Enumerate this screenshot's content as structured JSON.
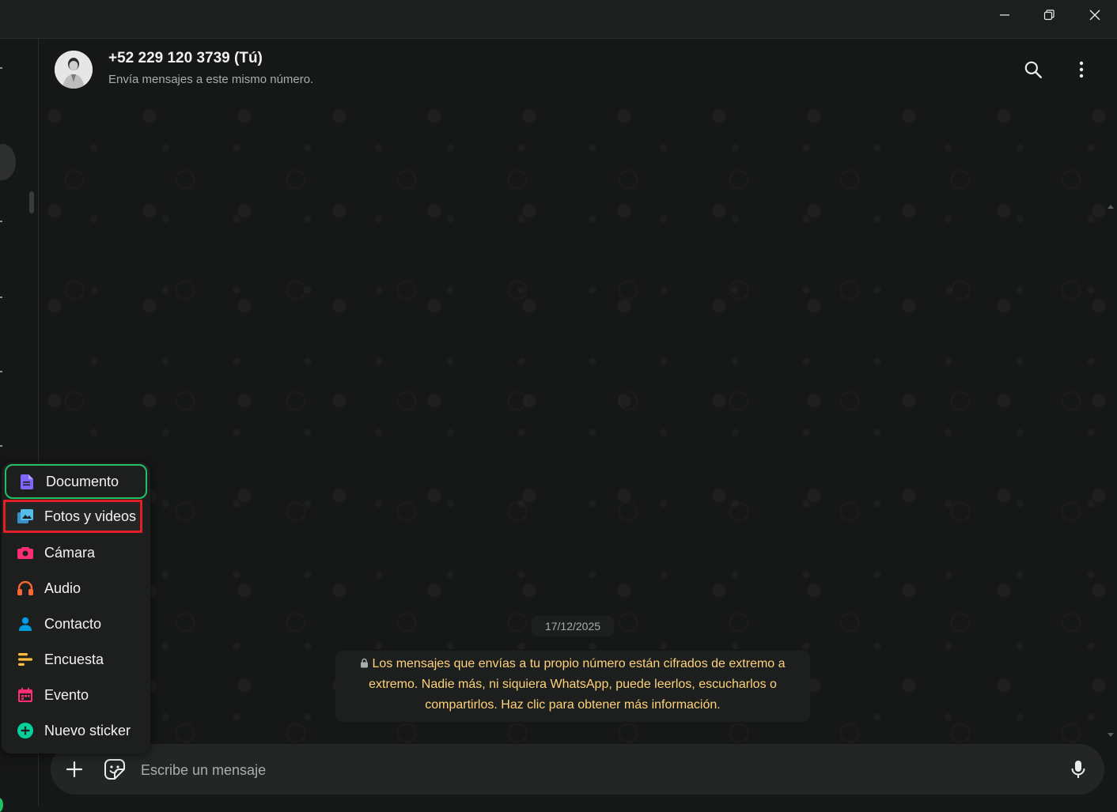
{
  "window": {
    "minimize_icon": "minimize-icon",
    "restore_icon": "restore-icon",
    "close_icon": "close-icon"
  },
  "header": {
    "name": "+52 229 120 3739 (Tú)",
    "subtitle": "Envía mensajes a este mismo número.",
    "icons": [
      "search-icon",
      "more-vertical-icon"
    ]
  },
  "chat": {
    "date": "17/12/2025",
    "notice": "Los mensajes que envías a tu propio número están cifrados de extremo a extremo. Nadie más, ni siquiera WhatsApp, puede leerlos, escucharlos o compartirlos. Haz clic para obtener más información."
  },
  "composer": {
    "placeholder": "Escribe un mensaje",
    "icons": [
      "plus-icon",
      "sticker-icon",
      "mic-icon"
    ]
  },
  "attach_menu": {
    "items": [
      {
        "label": "Documento",
        "icon": "document-icon",
        "color": "#7f66ff"
      },
      {
        "label": "Fotos y videos",
        "icon": "photos-icon",
        "color": "#53bdeb"
      },
      {
        "label": "Cámara",
        "icon": "camera-icon",
        "color": "#ff2e74"
      },
      {
        "label": "Audio",
        "icon": "headphones-icon",
        "color": "#fa6533"
      },
      {
        "label": "Contacto",
        "icon": "contact-icon",
        "color": "#009de2"
      },
      {
        "label": "Encuesta",
        "icon": "poll-icon",
        "color": "#ffbc38"
      },
      {
        "label": "Evento",
        "icon": "calendar-icon",
        "color": "#ff2e74"
      },
      {
        "label": "Nuevo sticker",
        "icon": "sticker-new-icon",
        "color": "#06cf9c"
      }
    ]
  },
  "colors": {
    "focus_outline": "#21c063",
    "annotation_highlight": "#e01f26",
    "notice_text": "#ffd279"
  }
}
